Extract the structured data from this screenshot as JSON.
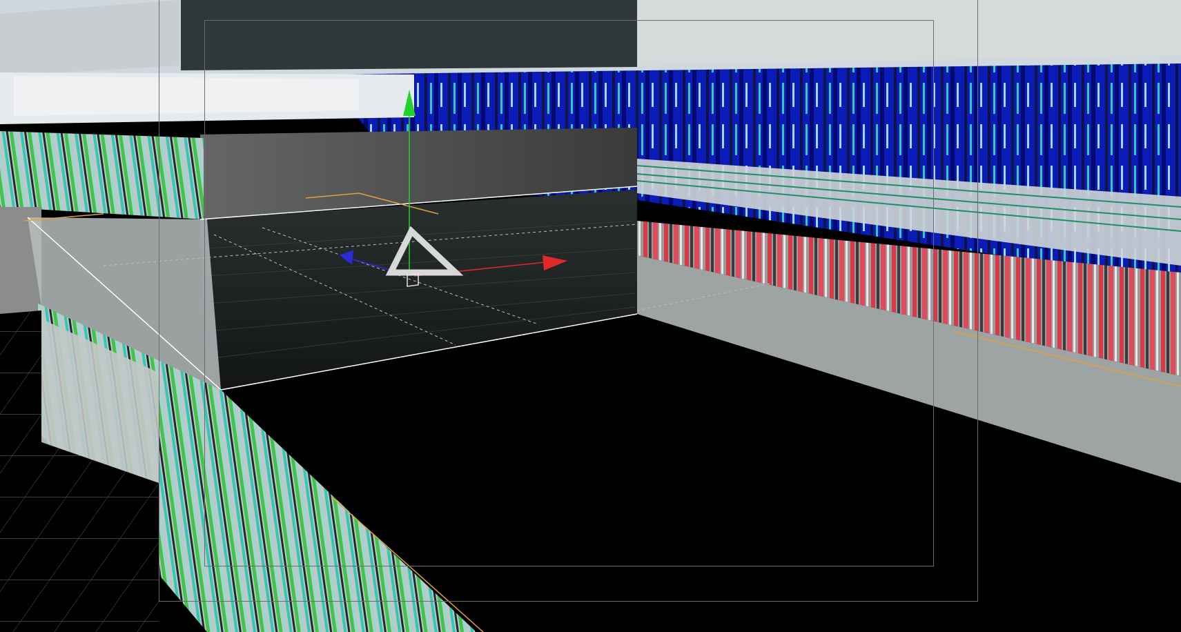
{
  "viewport": {
    "view_mode": "perspective",
    "selected_tool": "move-gizmo"
  },
  "colors": {
    "background": "#000000",
    "sky": "#cfd8de",
    "wall_light": "#c9cfd1",
    "wall_mid": "#9fa6a8",
    "floor_dark": "#1b1f1f",
    "ceiling_dark": "#2e3838",
    "texture_blue": "#0a1bb8",
    "texture_deep_blue": "#04096e",
    "texture_red": "#d83a4a",
    "texture_teal": "#2fc9b5",
    "texture_green": "#3fc64a",
    "axis_x": "#e02a2a",
    "axis_y": "#22d12c",
    "axis_z": "#2b2bd6",
    "selection_outline": "#e3a23a",
    "safe_frame": "#6b6b6b"
  },
  "gizmo": {
    "axes": [
      "x",
      "y",
      "z"
    ],
    "icons": [
      "camera-triangle-icon",
      "pivot-box-icon"
    ]
  }
}
